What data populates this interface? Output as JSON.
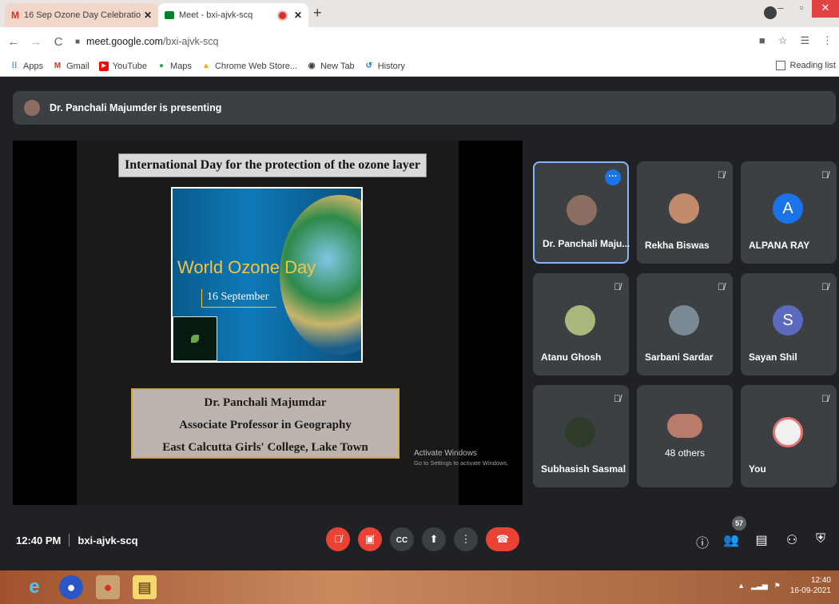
{
  "browser": {
    "tabs": [
      {
        "title": "16 Sep Ozone Day Celebration -",
        "icon": "gmail-icon"
      },
      {
        "title": "Meet - bxi-ajvk-scq",
        "icon": "meet-icon"
      }
    ],
    "url_host": "meet.google.com",
    "url_path": "/bxi-ajvk-scq",
    "bookmarks": [
      "Apps",
      "Gmail",
      "YouTube",
      "Maps",
      "Chrome Web Store...",
      "New Tab",
      "History"
    ],
    "reading_list": "Reading list"
  },
  "meet": {
    "presenting_banner": "Dr. Panchali Majumder is presenting",
    "slide": {
      "title": "International  Day for the protection  of  the ozone layer",
      "image_label": "World Ozone Day",
      "image_date": "16 September",
      "caption_lines": [
        "Dr. Panchali Majumdar",
        "Associate Professor in Geography",
        "East Calcutta Girls' College, Lake Town"
      ],
      "watermark_title": "Activate Windows",
      "watermark_sub": "Go to Settings to activate Windows."
    },
    "participants": [
      {
        "name": "Dr. Panchali Maju...",
        "avatar_color": "#8d6e63"
      },
      {
        "name": "Rekha Biswas",
        "avatar_color": "#c28b6e"
      },
      {
        "name": "ALPANA RAY",
        "avatar_letter": "A",
        "avatar_color": "#1a73e8"
      },
      {
        "name": "Atanu Ghosh",
        "avatar_color": "#a9b77a"
      },
      {
        "name": "Sarbani Sardar",
        "avatar_color": "#7a8a94"
      },
      {
        "name": "Sayan Shil",
        "avatar_letter": "S",
        "avatar_color": "#5c6bc0"
      },
      {
        "name": "Subhasish Sasmal",
        "avatar_color": "#2e3b2a"
      },
      {
        "others": "48 others"
      },
      {
        "name": "You",
        "avatar_color": "#f0f0f0"
      }
    ],
    "time": "12:40 PM",
    "meeting_code": "bxi-ajvk-scq",
    "people_count": "57"
  },
  "taskbar": {
    "time": "12:40",
    "date": "16-09-2021"
  },
  "colors": {
    "meet_bg": "#202124",
    "tile_bg": "#3c4043",
    "danger": "#ea4335",
    "accent": "#1a73e8"
  }
}
